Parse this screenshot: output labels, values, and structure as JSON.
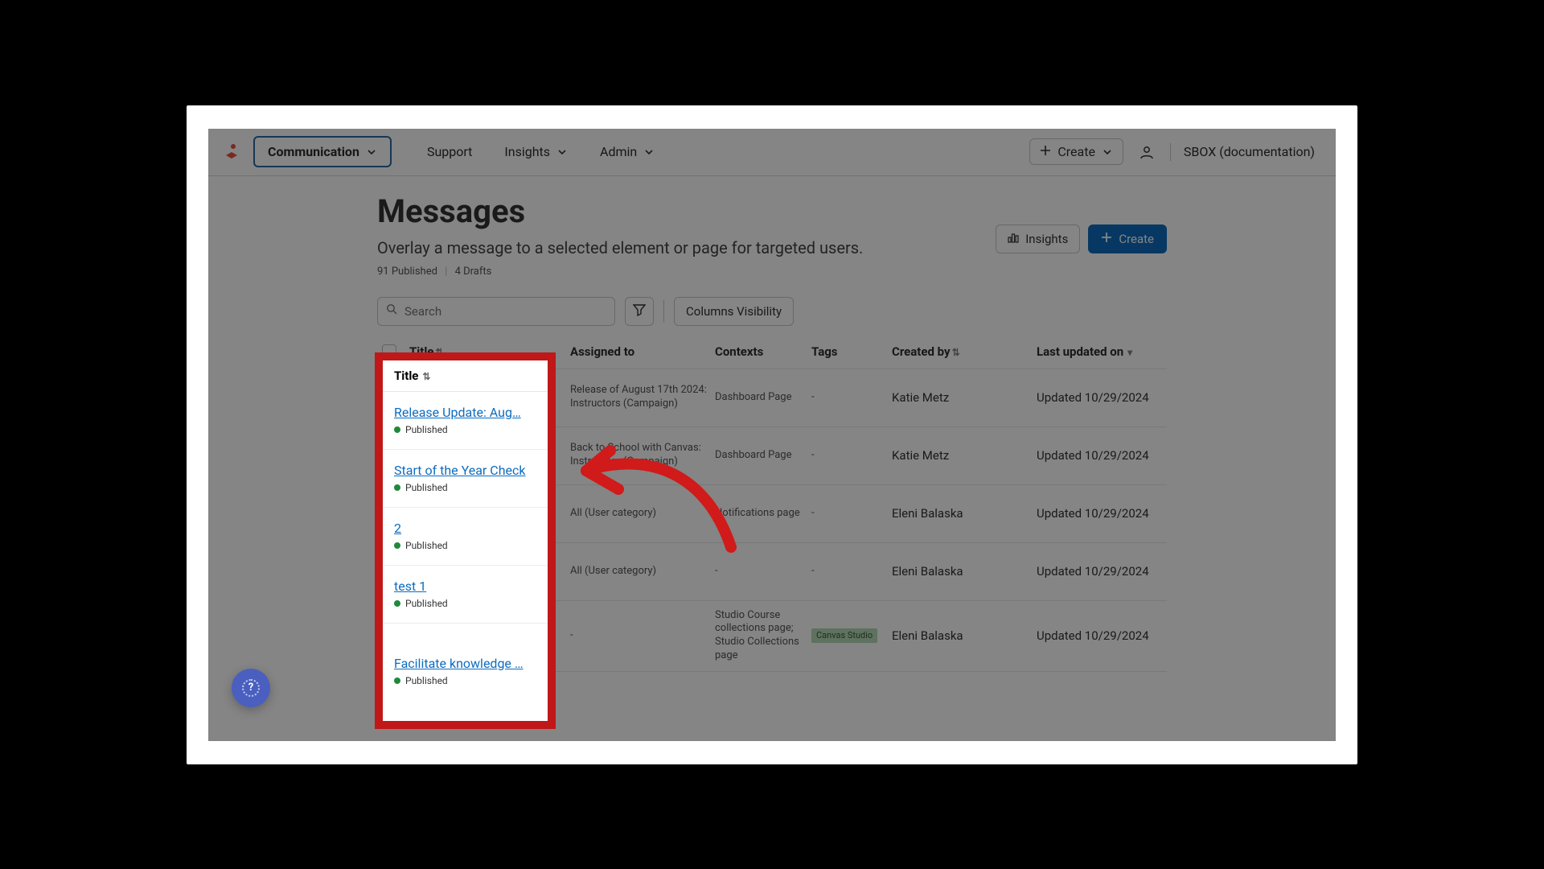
{
  "nav": {
    "communication": "Communication",
    "support": "Support",
    "insights": "Insights",
    "admin": "Admin",
    "create": "Create",
    "env": "SBOX (documentation)"
  },
  "page": {
    "title": "Messages",
    "subtitle": "Overlay a message to a selected element or page for targeted users.",
    "published_count": "91 Published",
    "drafts_count": "4 Drafts"
  },
  "actions": {
    "insights": "Insights",
    "create": "Create"
  },
  "toolbar": {
    "search_placeholder": "Search",
    "columns_visibility": "Columns Visibility"
  },
  "columns": {
    "title": "Title",
    "assigned_to": "Assigned to",
    "contexts": "Contexts",
    "tags": "Tags",
    "created_by": "Created by",
    "last_updated": "Last updated on"
  },
  "status": {
    "published": "Published"
  },
  "rows": [
    {
      "title": "Release Update: Aug…",
      "assigned": "Release of August 17th 2024: Instructors (Campaign)",
      "contexts": "Dashboard Page",
      "tags": "-",
      "tag_pill": "",
      "created_by": "Katie Metz",
      "updated": "Updated 10/29/2024"
    },
    {
      "title": "Start of the Year Check",
      "assigned": "Back to School with Canvas: Instructors (Campaign)",
      "contexts": "Dashboard Page",
      "tags": "-",
      "tag_pill": "",
      "created_by": "Katie Metz",
      "updated": "Updated 10/29/2024"
    },
    {
      "title": "2",
      "assigned": "All (User category)",
      "contexts": "Notifications page",
      "tags": "-",
      "tag_pill": "",
      "created_by": "Eleni Balaska",
      "updated": "Updated 10/29/2024"
    },
    {
      "title": "test 1",
      "assigned": "All (User category)",
      "contexts": "-",
      "tags": "-",
      "tag_pill": "",
      "created_by": "Eleni Balaska",
      "updated": "Updated 10/29/2024"
    },
    {
      "title": "Facilitate knowledge …",
      "assigned": "-",
      "contexts": "Studio Course collections page; Studio Collections page",
      "tags": "",
      "tag_pill": "Canvas Studio",
      "created_by": "Eleni Balaska",
      "updated": "Updated 10/29/2024"
    }
  ]
}
